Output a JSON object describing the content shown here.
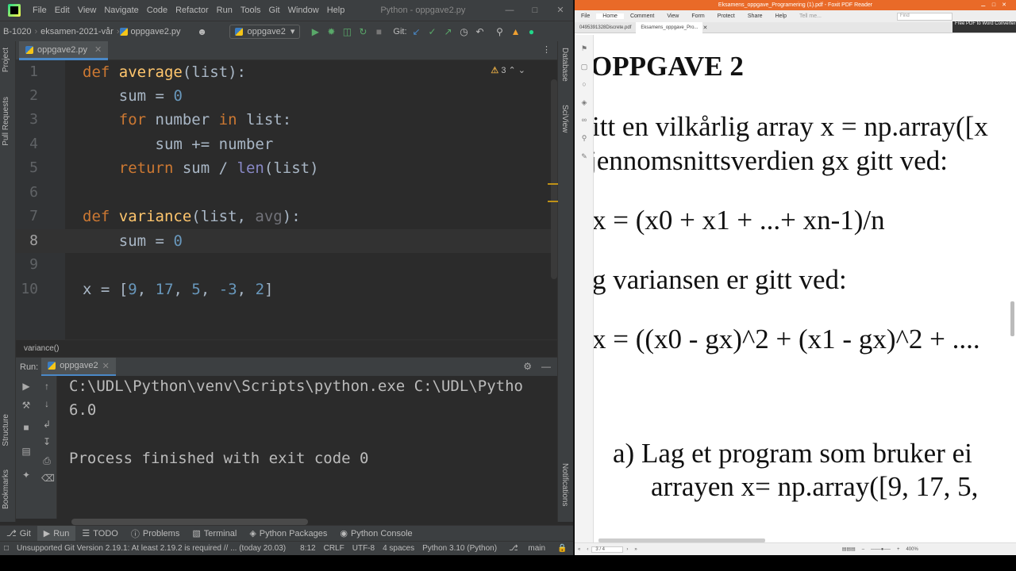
{
  "ide": {
    "menu": [
      "File",
      "Edit",
      "View",
      "Navigate",
      "Code",
      "Refactor",
      "Run",
      "Tools",
      "Git",
      "Window",
      "Help"
    ],
    "window_title": "Python - oppgave2.py",
    "breadcrumb": [
      "B-1020",
      "eksamen-2021-vår",
      "oppgave2.py"
    ],
    "run_config": "oppgave2",
    "git_label": "Git:",
    "editor_tab": "oppgave2.py",
    "warning_count": "3",
    "line_numbers": [
      "1",
      "2",
      "3",
      "4",
      "5",
      "6",
      "7",
      "8",
      "9",
      "10"
    ],
    "code_lines": [
      "def average(list):",
      "    sum = 0",
      "    for number in list:",
      "        sum += number",
      "    return sum / len(list)",
      "",
      "def variance(list, avg):",
      "    sum = 0",
      "",
      "x = [9, 17, 5, -3, 2]"
    ],
    "breadcrumb_fn": "variance()",
    "run_label": "Run:",
    "run_tab": "oppgave2",
    "console_lines": [
      "C:\\UDL\\Python\\venv\\Scripts\\python.exe C:\\UDL\\Pytho",
      "6.0",
      "",
      "Process finished with exit code 0"
    ],
    "left_tools": [
      "Project",
      "Pull Requests",
      "Structure",
      "Bookmarks"
    ],
    "right_tools": [
      "Database",
      "SciView",
      "Notifications"
    ],
    "bottom_tabs": [
      "Git",
      "Run",
      "TODO",
      "Problems",
      "Terminal",
      "Python Packages",
      "Python Console"
    ],
    "status": {
      "message": "Unsupported Git Version 2.19.1: At least 2.19.2 is required // ... (today 20.03)",
      "position": "8:12",
      "line_sep": "CRLF",
      "encoding": "UTF-8",
      "indent": "4 spaces",
      "interpreter": "Python 3.10 (Python)",
      "branch": "main"
    }
  },
  "pdf": {
    "title": "Eksamens_oppgave_Programering (1).pdf - Foxit PDF Reader",
    "ribbon": [
      "File",
      "Home",
      "Comment",
      "View",
      "Form",
      "Protect",
      "Share",
      "Help",
      "Tell me..."
    ],
    "find_placeholder": "Find",
    "tabs": [
      "0495391328Discrete.pdf",
      "Eksamens_oppgave_Pro..."
    ],
    "free_pdf": "Free PDF to Word Converter",
    "page_lines": [
      "OPPGAVE 2",
      "itt en vilkårlig array x = np.array([x",
      "jennomsnittsverdien gx gitt ved:",
      "x = (x0 + x1 + ...+ xn-1)/n",
      "g variansen er gitt ved:",
      "x = ((x0 - gx)^2 + (x1 - gx)^2 + ....",
      "a)   Lag et program som bruker ei",
      "arrayen  x= np.array([9, 17, 5,"
    ],
    "page_indicator": "3 / 4",
    "zoom": "400%"
  }
}
